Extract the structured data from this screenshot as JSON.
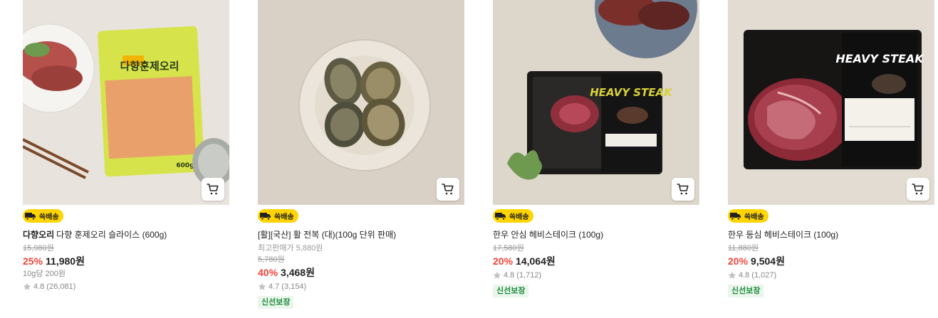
{
  "products": [
    {
      "badge": "쓱배송",
      "brand": "다향오리",
      "name": "다향 훈제오리 슬라이스 (600g)",
      "original_price": "15,980원",
      "discount": "25%",
      "price": "11,980원",
      "unit_price": "10g당 200원",
      "rating": "4.8",
      "reviews": "(26,081)",
      "package_label": "다향훈제오리",
      "package_weight": "600g",
      "image_color": "#e8e3dc"
    },
    {
      "badge": "쓱배송",
      "name": "[활][국산] 활 전복 (대)(100g 단위 판매)",
      "best_price": "최고판매가 5,880원",
      "original_price": "5,780원",
      "discount": "40%",
      "price": "3,468원",
      "rating": "4.7",
      "reviews": "(3,154)",
      "fresh_tag": "신선보장",
      "image_color": "#d9d1c6"
    },
    {
      "badge": "쓱배송",
      "name": "한우 안심 헤비스테이크 (100g)",
      "original_price": "17,580원",
      "discount": "20%",
      "price": "14,064원",
      "rating": "4.8",
      "reviews": "(1,712)",
      "fresh_tag": "신선보장",
      "package_label": "HEAVY STEAK",
      "image_color": "#ddd6cb"
    },
    {
      "badge": "쓱배송",
      "name": "한우 등심 헤비스테이크 (100g)",
      "original_price": "11,880원",
      "discount": "20%",
      "price": "9,504원",
      "rating": "4.8",
      "reviews": "(1,027)",
      "fresh_tag": "신선보장",
      "package_label": "HEAVY STEAK",
      "image_color": "#e2dcd3"
    }
  ],
  "icons": {
    "cart": "cart-icon",
    "truck": "delivery-truck-icon",
    "star": "star-icon"
  },
  "colors": {
    "badge_bg": "#ffd400",
    "discount": "#f0443a",
    "fresh": "#1b8b3a"
  }
}
